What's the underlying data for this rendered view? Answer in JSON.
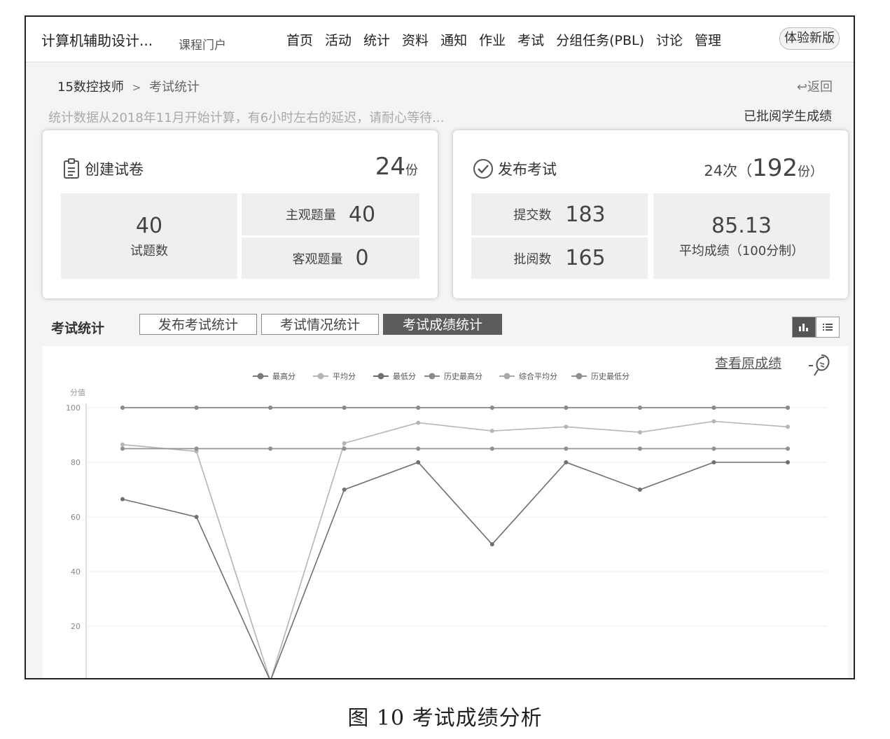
{
  "header": {
    "course_title": "计算机辅助设计...",
    "course_sub": "课程门户",
    "nav": [
      "首页",
      "活动",
      "统计",
      "资料",
      "通知",
      "作业",
      "考试",
      "分组任务(PBL)",
      "讨论",
      "管理"
    ],
    "new_version": "体验新版"
  },
  "breadcrumb": {
    "root": "15数控技师",
    "separator": ">",
    "current": "考试统计",
    "back": "返回"
  },
  "notice": "统计数据从2018年11月开始计算，有6小时左右的延迟，请耐心等待...",
  "filter": {
    "label": "已批阅学生成绩"
  },
  "card_create": {
    "title": "创建试卷",
    "count": "24",
    "count_unit": "份",
    "questions_value": "40",
    "questions_label": "试题数",
    "subjective_label": "主观题量",
    "subjective_value": "40",
    "objective_label": "客观题量",
    "objective_value": "0"
  },
  "card_publish": {
    "title": "发布考试",
    "times": "24次",
    "paren_open": "（",
    "copies": "192",
    "copies_unit": "份）",
    "submitted_label": "提交数",
    "submitted_value": "183",
    "reviewed_label": "批阅数",
    "reviewed_value": "165",
    "avg_value": "85.13",
    "avg_label": "平均成绩（100分制）"
  },
  "stats_tabs": {
    "label": "考试统计",
    "tabs": [
      "发布考试统计",
      "考试情况统计",
      "考试成绩统计"
    ],
    "active_index": 2
  },
  "chart_link": "查看原成绩",
  "chart_data": {
    "type": "line",
    "ylabel": "分值",
    "ylim": [
      0,
      100
    ],
    "yticks": [
      20,
      40,
      60,
      80,
      100
    ],
    "x": [
      1,
      2,
      3,
      4,
      5,
      6,
      7,
      8,
      9,
      10
    ],
    "grid": true,
    "legend_position": "top",
    "series": [
      {
        "name": "最高分",
        "color": "#7a7a7a",
        "values": [
          100,
          100,
          100,
          100,
          100,
          100,
          100,
          100,
          100,
          100
        ]
      },
      {
        "name": "平均分",
        "color": "#b5b5b5",
        "values": [
          86.5,
          84,
          0,
          87,
          94.5,
          91.5,
          93,
          91,
          95,
          93
        ]
      },
      {
        "name": "最低分",
        "color": "#707070",
        "values": [
          66.5,
          60,
          0,
          70,
          80,
          50,
          80,
          70,
          80,
          80
        ]
      },
      {
        "name": "历史最高分",
        "color": "#8a8a8a",
        "values": [
          100,
          100,
          100,
          100,
          100,
          100,
          100,
          100,
          100,
          100
        ]
      },
      {
        "name": "综合平均分",
        "color": "#a8a8a8",
        "values": [
          85,
          85,
          85,
          85,
          85,
          85,
          85,
          85,
          85,
          85
        ]
      },
      {
        "name": "历史最低分",
        "color": "#909090",
        "values": [
          85,
          85,
          85,
          85,
          85,
          85,
          85,
          85,
          85,
          85
        ]
      }
    ]
  },
  "caption": "图 10   考试成绩分析"
}
